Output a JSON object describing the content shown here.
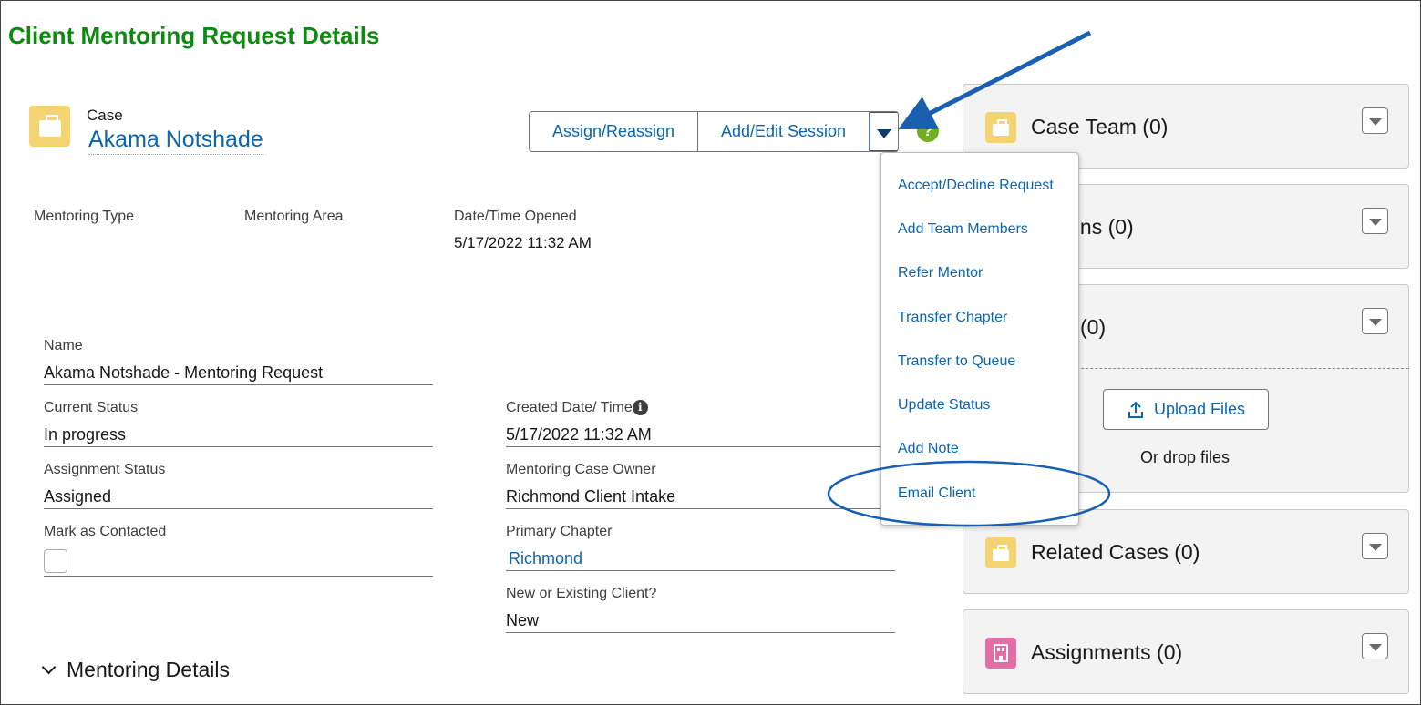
{
  "page": {
    "title": "Client Mentoring Request Details"
  },
  "record": {
    "type": "Case",
    "name": "Akama Notshade"
  },
  "actions": {
    "assign": "Assign/Reassign",
    "edit_session": "Add/Edit Session"
  },
  "highlights": [
    {
      "label": "Mentoring Type",
      "value": ""
    },
    {
      "label": "Mentoring Area",
      "value": ""
    },
    {
      "label": "Date/Time Opened",
      "value": "5/17/2022 11:32 AM"
    }
  ],
  "fields_left": {
    "name": {
      "label": "Name",
      "value": "Akama Notshade - Mentoring Request"
    },
    "current_status": {
      "label": "Current Status",
      "value": "In progress"
    },
    "assignment_status": {
      "label": "Assignment Status",
      "value": "Assigned"
    },
    "mark_contacted": {
      "label": "Mark as Contacted",
      "checked": false
    }
  },
  "fields_right": {
    "created": {
      "label": "Created Date/ Time",
      "value": "5/17/2022 11:32 AM"
    },
    "owner": {
      "label": "Mentoring Case Owner",
      "value": "Richmond Client Intake"
    },
    "chapter": {
      "label": "Primary Chapter",
      "value": "Richmond"
    },
    "new_existing": {
      "label": "New or Existing Client?",
      "value": "New"
    }
  },
  "section": {
    "title": "Mentoring Details"
  },
  "dropdown_menu": {
    "items": [
      "Accept/Decline Request",
      "Add Team Members",
      "Refer Mentor",
      "Transfer Chapter",
      "Transfer to Queue",
      "Update Status",
      "Add Note",
      "Email Client"
    ],
    "highlighted": "Email Client"
  },
  "related_cards": {
    "case_team": "Case Team (0)",
    "sessions": "ions (0)",
    "files": "(0)",
    "upload_label": "Upload Files",
    "drop_text": "Or drop files",
    "related_cases": "Related Cases (0)",
    "assignments": "Assignments (0)"
  },
  "colors": {
    "title_green": "#0f8a10",
    "link_blue": "#0b66b2",
    "annotation_blue": "#1b5fb0"
  }
}
